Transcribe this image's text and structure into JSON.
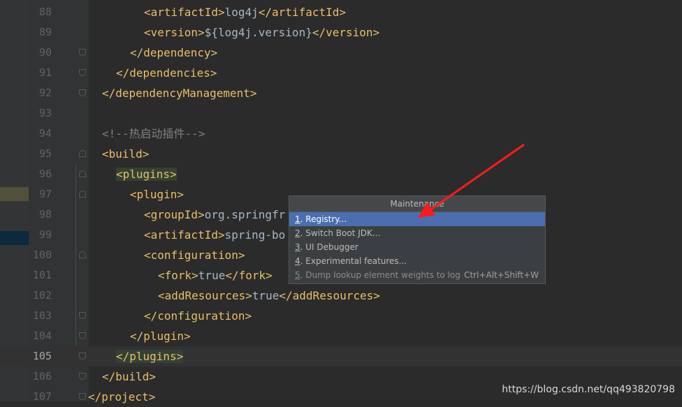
{
  "editor": {
    "current_line": "105",
    "lines": [
      {
        "num": "88",
        "parts": [
          "<artifactId>",
          "log4j",
          "</artifactId>"
        ]
      },
      {
        "num": "89",
        "parts": [
          "<version>",
          "${log4j.version}",
          "</version>"
        ]
      },
      {
        "num": "90",
        "parts": [
          "</dependency>"
        ]
      },
      {
        "num": "91",
        "parts": [
          "</dependencies>"
        ]
      },
      {
        "num": "92",
        "parts": [
          "</dependencyManagement>"
        ]
      },
      {
        "num": "93",
        "parts": []
      },
      {
        "num": "94",
        "parts": [
          "<!--热启动插件-->"
        ]
      },
      {
        "num": "95",
        "parts": [
          "<build>"
        ]
      },
      {
        "num": "96",
        "parts": [
          "<plugins>"
        ]
      },
      {
        "num": "97",
        "parts": [
          "<plugin>"
        ]
      },
      {
        "num": "98",
        "parts": [
          "<groupId>",
          "org.springfr"
        ]
      },
      {
        "num": "99",
        "parts": [
          "<artifactId>",
          "spring-bo"
        ]
      },
      {
        "num": "100",
        "parts": [
          "<configuration>"
        ]
      },
      {
        "num": "101",
        "parts": [
          "<fork>",
          "true",
          "</fork>"
        ]
      },
      {
        "num": "102",
        "parts": [
          "<addResources>",
          "true",
          "</addResources>"
        ]
      },
      {
        "num": "103",
        "parts": [
          "</configuration>"
        ]
      },
      {
        "num": "104",
        "parts": [
          "</plugin>"
        ]
      },
      {
        "num": "105",
        "parts": [
          "</plugins>"
        ]
      },
      {
        "num": "106",
        "parts": [
          "</build>"
        ]
      },
      {
        "num": "107",
        "parts": [
          "</project>"
        ]
      }
    ]
  },
  "popup": {
    "title": "Maintenance",
    "items": [
      {
        "num": "1",
        "label": ". Registry...",
        "shortcut": "",
        "selected": true
      },
      {
        "num": "2",
        "label": ". Switch Boot JDK...",
        "shortcut": "",
        "selected": false
      },
      {
        "num": "3",
        "label": ". UI Debugger",
        "shortcut": "",
        "selected": false
      },
      {
        "num": "4",
        "label": ". Experimental features...",
        "shortcut": "",
        "selected": false
      },
      {
        "num": "5",
        "label": ". Dump lookup element weights to log",
        "shortcut": "Ctrl+Alt+Shift+W",
        "selected": false,
        "disabled": true
      }
    ]
  },
  "watermark": "https://blog.csdn.net/qq493820798",
  "colors": {
    "tag": "#e8bf6a",
    "text": "#a9b7c6",
    "comment": "#808080",
    "selection": "#4b6eaf",
    "annotation_arrow": "#ff1a1a"
  }
}
